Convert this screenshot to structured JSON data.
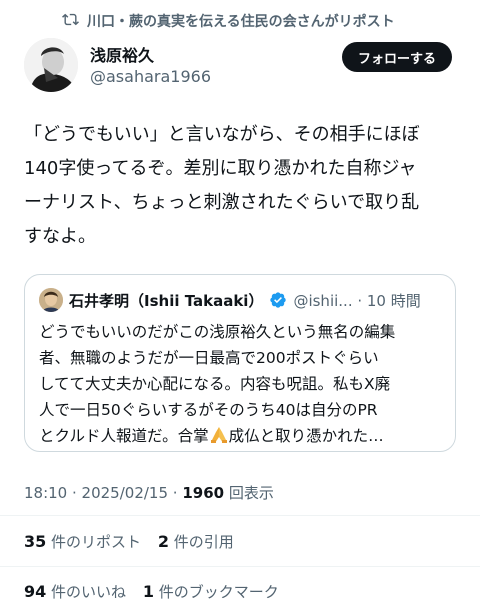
{
  "repost_banner": {
    "text": "川口・蕨の真実を伝える住民の会さんがリポスト",
    "icon": "repost-icon"
  },
  "author": {
    "name": "浅原裕久",
    "handle": "@asahara1966",
    "follow_label": "フォローする"
  },
  "post": {
    "text": "「どうでもいい」と言いながら、その相手にほぼ\n140字使ってるぞ。差別に取り憑かれた自称ジャ\nーナリスト、ちょっと刺激されたぐらいで取り乱\nすなよ。"
  },
  "quote": {
    "name": "石井孝明（Ishii Takaaki）",
    "handle_time": "@ishii... · 10 時間",
    "text_before_emoji": "どうでもいいのだがこの浅原裕久という無名の編集\n者、無職のようだが一日最高で200ポストぐらい\nしてて大丈夫か心配になる。内容も呪詛。私もX廃\n人で一日50ぐらいするがそのうち40は自分のPR\nとクルド人報道だ。合掌",
    "text_after_emoji": "成仏と取り憑かれた…"
  },
  "meta": {
    "time": "18:10",
    "sep1": " · ",
    "date": "2025/02/15",
    "sep2": " · ",
    "views_count": "1960",
    "views_label": " 回表示"
  },
  "stats": {
    "reposts_count": "35",
    "reposts_label": " 件のリポスト",
    "quotes_count": "2",
    "quotes_label": " 件の引用",
    "likes_count": "94",
    "likes_label": " 件のいいね",
    "bookmarks_count": "1",
    "bookmarks_label": " 件のブックマーク"
  },
  "colors": {
    "text": "#0f1419",
    "secondary": "#536471",
    "verified": "#1d9bf0",
    "border": "#cfd9de"
  }
}
